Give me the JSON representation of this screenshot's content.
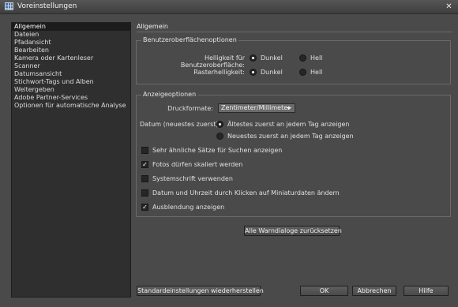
{
  "window": {
    "title": "Voreinstellungen",
    "close_glyph": "✕"
  },
  "sidebar": {
    "items": [
      {
        "label": "Allgemein",
        "selected": true
      },
      {
        "label": "Dateien"
      },
      {
        "label": "Pfadansicht"
      },
      {
        "label": "Bearbeiten"
      },
      {
        "label": "Kamera oder Kartenleser"
      },
      {
        "label": "Scanner"
      },
      {
        "label": "Datumsansicht"
      },
      {
        "label": "Stichwort-Tags und Alben"
      },
      {
        "label": "Weitergeben"
      },
      {
        "label": "Adobe Partner-Services"
      },
      {
        "label": "Optionen für automatische Analyse"
      }
    ]
  },
  "main": {
    "title": "Allgemein"
  },
  "ui_group": {
    "legend": "Benutzeroberflächenoptionen",
    "brightness_label": "Helligkeit für Benutzeroberfläche:",
    "raster_label": "Rasterhelligkeit:",
    "dark": "Dunkel",
    "light": "Hell",
    "brightness_value": "Dunkel",
    "raster_value": "Dunkel"
  },
  "display_group": {
    "legend": "Anzeigeoptionen",
    "print_format_label": "Druckformate:",
    "print_format_value": "Zentimeter/Millimeter",
    "date_label": "Datum (neuestes zuerst):",
    "date_option_oldest": "Ältestes zuerst an jedem Tag anzeigen",
    "date_option_newest": "Neuestes zuerst an jedem Tag anzeigen",
    "date_value": "oldest"
  },
  "checkboxes": [
    {
      "label": "Sehr ähnliche Sätze für Suchen anzeigen",
      "checked": false
    },
    {
      "label": "Fotos dürfen skaliert werden",
      "checked": true
    },
    {
      "label": "Systemschrift verwenden",
      "checked": false
    },
    {
      "label": "Datum und Uhrzeit durch Klicken auf Miniaturdaten ändern",
      "checked": false
    },
    {
      "label": "Ausblendung anzeigen",
      "checked": true
    }
  ],
  "check_glyph": "✓",
  "buttons": {
    "reset_warnings": "Alle Warndialoge zurücksetzen",
    "restore_defaults": "Standardeinstellungen wiederherstellen",
    "ok": "OK",
    "cancel": "Abbrechen",
    "help": "Hilfe"
  }
}
